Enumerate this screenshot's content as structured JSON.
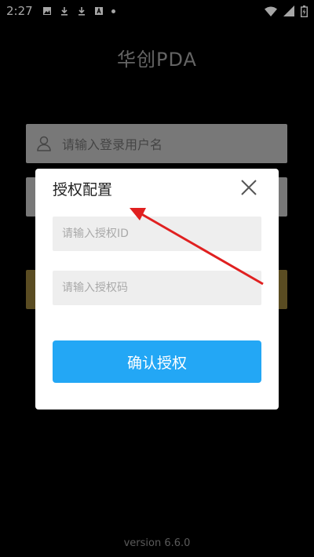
{
  "status_bar": {
    "time": "2:27",
    "icons_left": [
      "image-icon",
      "download-icon",
      "download-icon",
      "app-icon",
      "dot-icon"
    ],
    "icons_right": [
      "wifi-icon",
      "signal-icon",
      "battery-icon"
    ]
  },
  "app": {
    "title": "华创PDA",
    "username_placeholder": "请输入登录用户名",
    "version": "version 6.6.0"
  },
  "dialog": {
    "title": "授权配置",
    "auth_id_placeholder": "请输入授权ID",
    "auth_code_placeholder": "请输入授权码",
    "confirm_label": "确认授权"
  },
  "colors": {
    "background": "#000000",
    "dialog_bg": "#ffffff",
    "confirm_button": "#23a7f5",
    "input_bg": "#eeeeee",
    "arrow": "#e02020",
    "login_button_dimmed": "#e6c458"
  }
}
